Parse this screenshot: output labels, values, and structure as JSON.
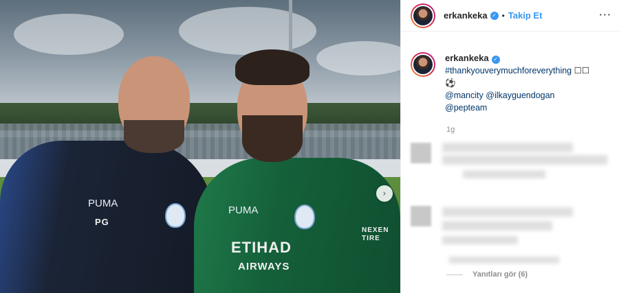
{
  "post": {
    "username": "erkankeka",
    "follow_label": "Takip Et",
    "separator": "•",
    "more_label": "···"
  },
  "caption": {
    "username": "erkankeka",
    "hashtag": "#thankyouverymuchforeverything",
    "emoji_boxes": "☐☐",
    "ball": "⚽",
    "mentions": [
      "@mancity",
      "@ilkayguendogan",
      "@pepteam"
    ],
    "timestamp": "1g"
  },
  "photo": {
    "left_initials": "PG",
    "sponsor_line1": "ETIHAD",
    "sponsor_line2": "AIRWAYS",
    "sleeve_text": "NEXEN TIRE",
    "brand": "PUMA",
    "next_label": "›"
  },
  "comments": {
    "view_replies_label": "Yanıtları gör (6)"
  },
  "colors": {
    "link": "#003569",
    "accent": "#3897f0",
    "muted": "#8e8e8e"
  }
}
